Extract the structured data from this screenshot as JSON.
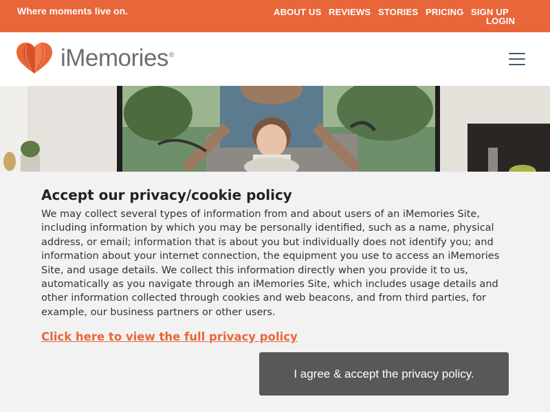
{
  "topbar": {
    "tagline": "Where moments live on.",
    "nav": [
      {
        "label": "ABOUT US"
      },
      {
        "label": "REVIEWS"
      },
      {
        "label": "STORIES"
      },
      {
        "label": "PRICING"
      },
      {
        "label": "SIGN UP"
      },
      {
        "label": "LOGIN"
      }
    ],
    "color": "#e8663a"
  },
  "header": {
    "logo_text": "iMemories",
    "logo_mark": "®",
    "logo_icon": "heart-logo-icon",
    "menu_icon": "hamburger-menu-icon"
  },
  "hero": {
    "image": "photo of father and child riding a scooter"
  },
  "cookie": {
    "title": "Accept our privacy/cookie policy",
    "body": "We may collect several types of information from and about users of an iMemories Site, including information by which you may be personally identified, such as a name, physical address, or email; information that is about you but individually does not identify you; and information about your internet connection, the equipment you use to access an iMemories Site, and usage details. We collect this information directly when you provide it to us, automatically as you navigate through an iMemories Site, which includes usage details and other information collected through cookies and web beacons, and from third parties, for example, our business partners or other users.",
    "link": "Click here to view the full privacy policy",
    "agree_button": "I agree & accept the privacy policy.",
    "button_color": "#58585a"
  }
}
